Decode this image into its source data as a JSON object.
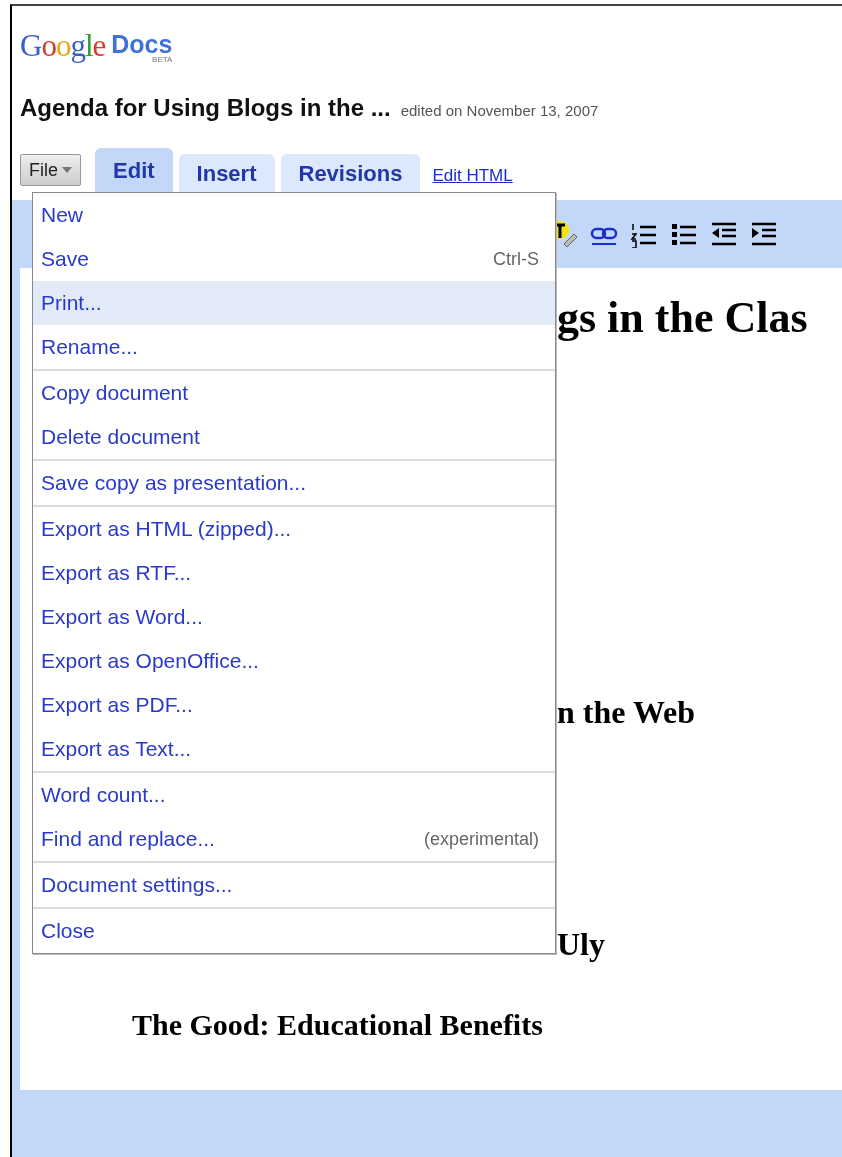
{
  "logo": {
    "brand": "Google",
    "product": "Docs",
    "badge": "BETA"
  },
  "document": {
    "title": "Agenda for Using Blogs in the ...",
    "edited": "edited on November 13, 2007"
  },
  "toolbar": {
    "file_menu": {
      "label": "File",
      "expanded": true
    },
    "tabs": [
      {
        "label": "Edit",
        "selected": true
      },
      {
        "label": "Insert",
        "selected": false
      },
      {
        "label": "Revisions",
        "selected": false
      }
    ],
    "link": "Edit HTML"
  },
  "file_menu": {
    "sections": [
      {
        "items": [
          {
            "label": "New",
            "selected": false
          },
          {
            "label": "Save",
            "shortcut": "Ctrl-S",
            "selected": false
          },
          {
            "label": "Print...",
            "selected": true
          },
          {
            "label": "Rename...",
            "selected": false
          }
        ]
      },
      {
        "items": [
          {
            "label": "Copy document",
            "selected": false
          },
          {
            "label": "Delete document",
            "selected": false
          }
        ]
      },
      {
        "items": [
          {
            "label": "Save copy as presentation...",
            "selected": false
          }
        ]
      },
      {
        "items": [
          {
            "label": "Export as HTML (zipped)...",
            "selected": false
          },
          {
            "label": "Export as RTF...",
            "selected": false
          },
          {
            "label": "Export as Word...",
            "selected": false
          },
          {
            "label": "Export as OpenOffice...",
            "selected": false
          },
          {
            "label": "Export as PDF...",
            "selected": false
          },
          {
            "label": "Export as Text...",
            "selected": false
          }
        ]
      },
      {
        "items": [
          {
            "label": "Word count...",
            "selected": false
          },
          {
            "label": "Find and replace...",
            "shortcut": "(experimental)",
            "selected": false
          }
        ]
      },
      {
        "items": [
          {
            "label": "Document settings...",
            "selected": false
          }
        ]
      },
      {
        "items": [
          {
            "label": "Close",
            "selected": false
          }
        ]
      }
    ]
  },
  "body": [
    {
      "kind": "title",
      "text": "gs in the Clas"
    },
    {
      "kind": "heading",
      "text": "n the Web"
    },
    {
      "kind": "heading",
      "text": "Uly"
    },
    {
      "kind": "subheading",
      "text": "The Good: Educational Benefits"
    }
  ]
}
